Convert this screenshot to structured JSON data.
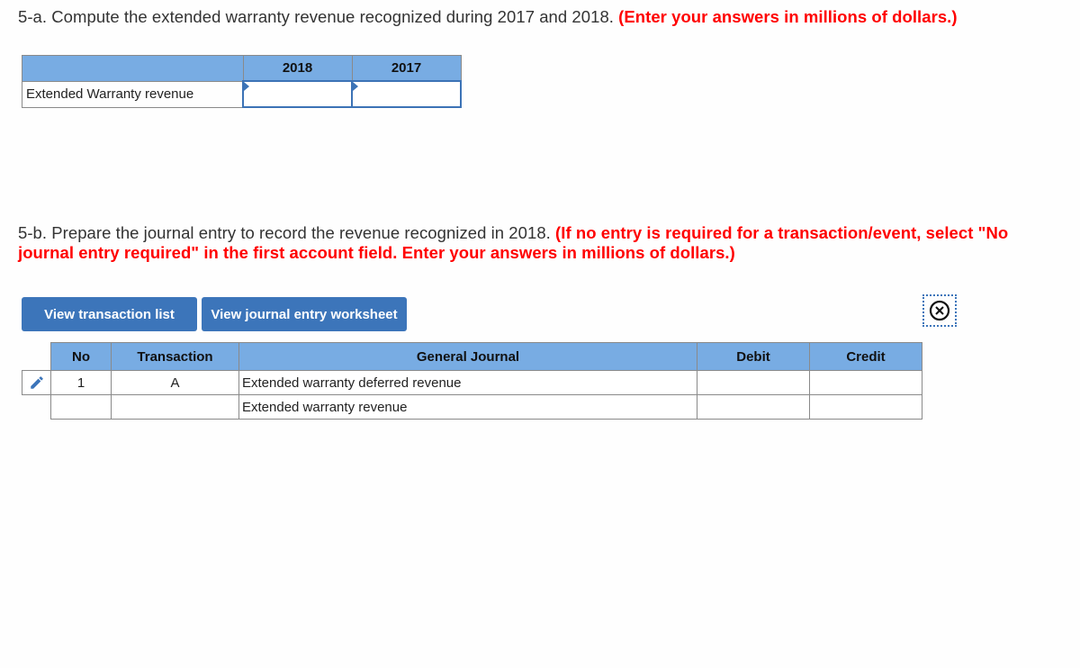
{
  "question_5a": {
    "prefix": "5-a. Compute the extended warranty revenue recognized during 2017 and 2018. ",
    "instruction": "(Enter your answers in millions of dollars.)"
  },
  "table_5a": {
    "headers": [
      "",
      "2018",
      "2017"
    ],
    "rows": [
      {
        "label": "Extended Warranty revenue",
        "values": [
          "",
          ""
        ]
      }
    ]
  },
  "question_5b": {
    "prefix": "5-b. Prepare the journal entry to record the revenue recognized in 2018. ",
    "instruction": "(If no entry is required for a transaction/event, select \"No journal entry required\" in the first account field. Enter your answers in millions of dollars.)"
  },
  "buttons": {
    "view_transaction_list": "View transaction list",
    "view_journal_entry_worksheet": "View journal entry worksheet"
  },
  "icons": {
    "close": "close-circle-icon",
    "edit": "pencil-icon"
  },
  "journal": {
    "headers": {
      "no": "No",
      "transaction": "Transaction",
      "general_journal": "General Journal",
      "debit": "Debit",
      "credit": "Credit"
    },
    "rows": [
      {
        "no": "1",
        "transaction": "A",
        "account": "Extended warranty deferred revenue",
        "debit": "",
        "credit": ""
      },
      {
        "no": "",
        "transaction": "",
        "account": "Extended warranty revenue",
        "debit": "",
        "credit": ""
      }
    ]
  },
  "colors": {
    "header_blue": "#78ace3",
    "button_blue": "#3c75ba",
    "instruction_red": "#ff0000"
  }
}
